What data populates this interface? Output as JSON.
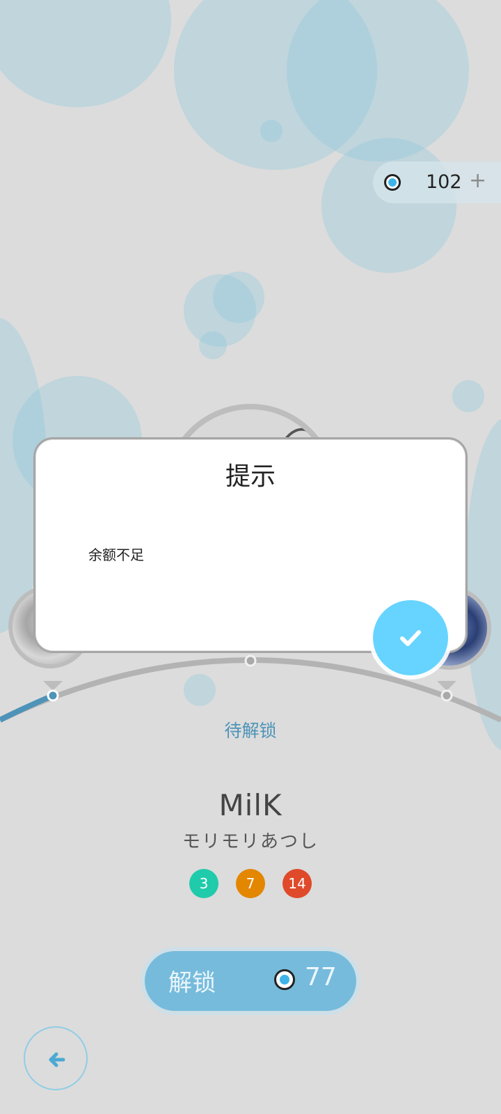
{
  "currency": {
    "balance": "102",
    "plus_label": "+",
    "icon": "coin-icon"
  },
  "dialog": {
    "title": "提示",
    "message": "余额不足",
    "confirm_icon": "check-icon"
  },
  "song": {
    "status": "待解锁",
    "title": "MilK",
    "artist": "モリモリあつし",
    "difficulties": {
      "easy": "3",
      "normal": "7",
      "hard": "14"
    }
  },
  "unlock": {
    "label": "解锁",
    "price": "77",
    "icon": "coin-icon"
  },
  "navigation": {
    "back_icon": "arrow-left-icon"
  },
  "colors": {
    "accent": "#66d4ff",
    "unlock_button": "#76bbdc",
    "status_text": "#4e93b8",
    "difficulty_easy": "#1fcbaa",
    "difficulty_normal": "#e38600",
    "difficulty_hard": "#df4a2a"
  }
}
